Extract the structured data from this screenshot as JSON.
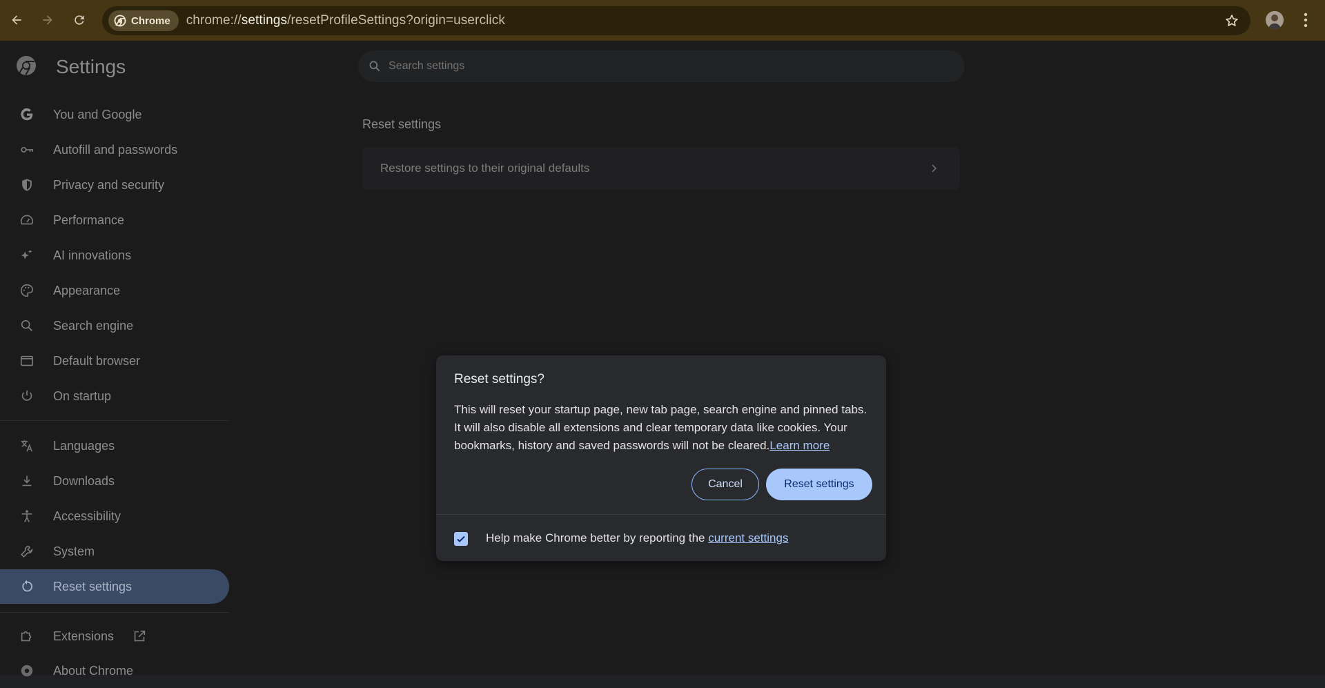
{
  "browser": {
    "chip_label": "Chrome",
    "url_prefix": "chrome://",
    "url_host": "settings",
    "url_path": "/resetProfileSettings?origin=userclick"
  },
  "header": {
    "title": "Settings",
    "search_placeholder": "Search settings"
  },
  "sidebar": {
    "items": [
      {
        "label": "You and Google",
        "icon": "google-g-icon"
      },
      {
        "label": "Autofill and passwords",
        "icon": "key-icon"
      },
      {
        "label": "Privacy and security",
        "icon": "shield-icon"
      },
      {
        "label": "Performance",
        "icon": "speedometer-icon"
      },
      {
        "label": "AI innovations",
        "icon": "sparkle-icon"
      },
      {
        "label": "Appearance",
        "icon": "palette-icon"
      },
      {
        "label": "Search engine",
        "icon": "search-icon"
      },
      {
        "label": "Default browser",
        "icon": "browser-window-icon"
      },
      {
        "label": "On startup",
        "icon": "power-icon"
      },
      {
        "label": "Languages",
        "icon": "translate-icon"
      },
      {
        "label": "Downloads",
        "icon": "download-icon"
      },
      {
        "label": "Accessibility",
        "icon": "accessibility-icon"
      },
      {
        "label": "System",
        "icon": "wrench-icon"
      },
      {
        "label": "Reset settings",
        "icon": "reset-icon",
        "active": true
      },
      {
        "label": "Extensions",
        "icon": "puzzle-icon"
      },
      {
        "label": "About Chrome",
        "icon": "chrome-icon"
      }
    ]
  },
  "main": {
    "section_title": "Reset settings",
    "card_label": "Restore settings to their original defaults"
  },
  "dialog": {
    "title": "Reset settings?",
    "body": "This will reset your startup page, new tab page, search engine and pinned tabs. It will also disable all extensions and clear temporary data like cookies. Your bookmarks, history and saved passwords will not be cleared.",
    "learn_more": "Learn more",
    "cancel_label": "Cancel",
    "reset_label": "Reset settings",
    "checkbox_checked": true,
    "footer_text": "Help make Chrome better by reporting the ",
    "footer_link": "current settings"
  },
  "colors": {
    "topbar": "#463613",
    "page_bg": "#1b1b1c",
    "accent": "#a8c7fa",
    "active_nav": "#3b4a64"
  }
}
